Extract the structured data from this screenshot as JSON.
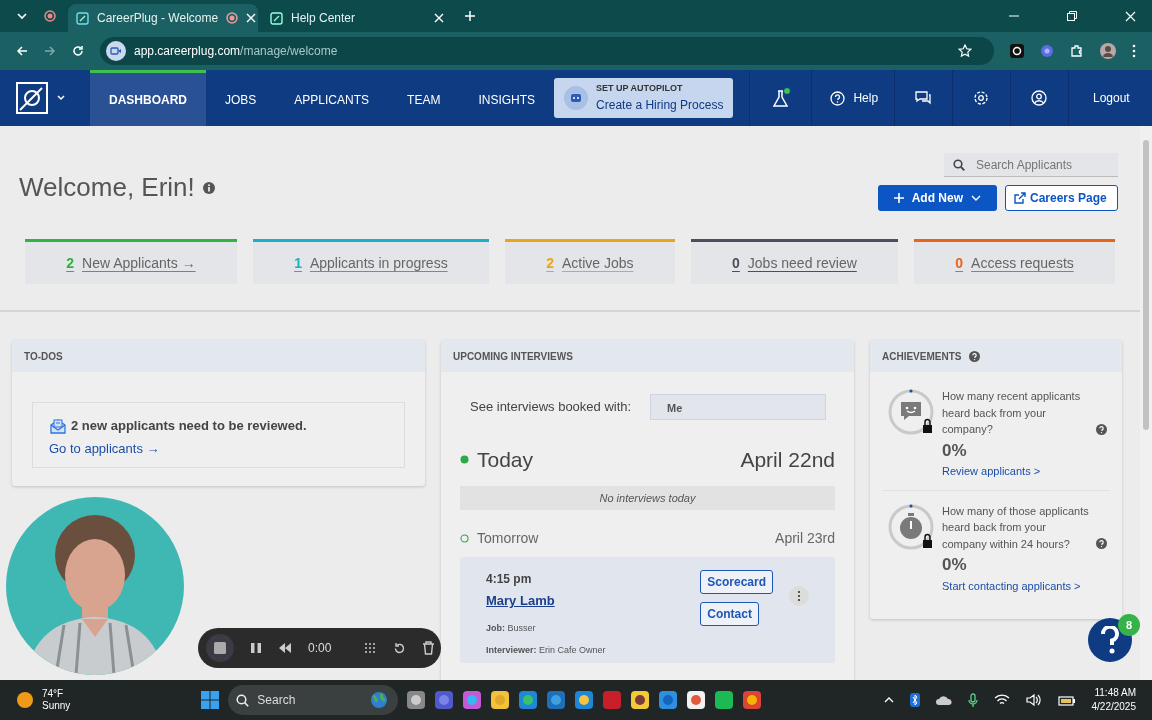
{
  "browser": {
    "tabs": [
      {
        "title": "CareerPlug - Welcome",
        "selected": true,
        "recording": true
      },
      {
        "title": "Help Center",
        "selected": false,
        "recording": false
      }
    ],
    "url_host": "app.careerplug.com",
    "url_path": "/manage/welcome"
  },
  "nav": {
    "items": [
      {
        "label": "DASHBOARD",
        "selected": true
      },
      {
        "label": "JOBS",
        "selected": false
      },
      {
        "label": "APPLICANTS",
        "selected": false
      },
      {
        "label": "TEAM",
        "selected": false
      },
      {
        "label": "INSIGHTS",
        "selected": false
      }
    ],
    "autopilot": {
      "title": "SET UP AUTOPILOT",
      "link": "Create a Hiring Process"
    },
    "help": "Help",
    "logout": "Logout"
  },
  "welcome": {
    "title": "Welcome, Erin!",
    "search_placeholder": "Search Applicants",
    "add_new": "Add New",
    "careers": "Careers Page"
  },
  "stats": [
    {
      "count": "2",
      "label": "New Applicants",
      "arrow": "→",
      "color": "#2fb344"
    },
    {
      "count": "1",
      "label": "Applicants in progress",
      "color": "#1ab0c8"
    },
    {
      "count": "2",
      "label": "Active Jobs",
      "color": "#e9a61a"
    },
    {
      "count": "0",
      "label": "Jobs need review",
      "color": "#4a4f5c"
    },
    {
      "count": "0",
      "label": "Access requests",
      "color": "#e8641b"
    }
  ],
  "todos": {
    "title": "TO-DOS",
    "message": "2 new applicants need to be reviewed.",
    "link": "Go to applicants →"
  },
  "interviews": {
    "title": "UPCOMING INTERVIEWS",
    "filter_label": "See interviews booked with:",
    "filter_value": "Me",
    "days": [
      {
        "label": "Today",
        "date": "April 22nd",
        "current": true,
        "empty_text": "No interviews today"
      },
      {
        "label": "Tomorrow",
        "date": "April 23rd",
        "current": false,
        "items": [
          {
            "time": "4:15 pm",
            "name": "Mary Lamb",
            "job": "**Job:** Busser",
            "interviewer": "**Interviewer:** Erin Cafe Owner",
            "actions": [
              "Scorecard",
              "Contact"
            ]
          }
        ]
      }
    ]
  },
  "achievements": {
    "title": "ACHIEVEMENTS",
    "items": [
      {
        "kind": "chat",
        "question": "How many recent applicants heard back from your company?",
        "value": "0%",
        "link": "Review applicants >"
      },
      {
        "kind": "timer",
        "question": "How many of those applicants heard back from your company within 24 hours?",
        "value": "0%",
        "link": "Start contacting applicants >"
      }
    ]
  },
  "recorder": {
    "time": "0:00"
  },
  "help_badge": "8",
  "taskbar": {
    "temperature": "74°F",
    "condition": "Sunny",
    "search": "Search",
    "time": "11:48 AM",
    "date": "4/22/2025"
  }
}
